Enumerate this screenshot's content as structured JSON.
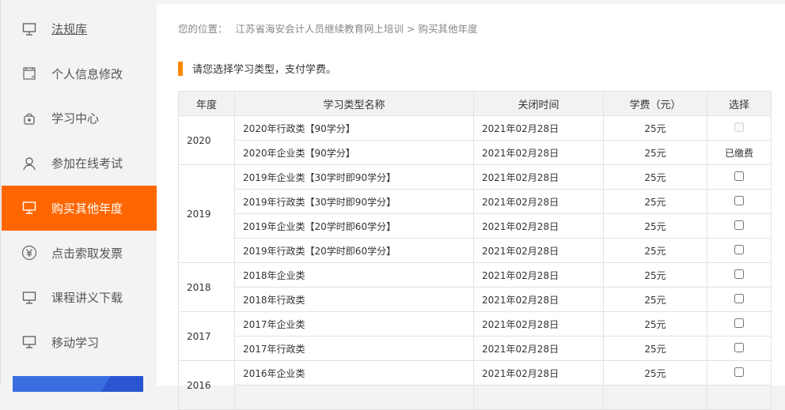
{
  "sidebar": {
    "items": [
      {
        "label": "法规库",
        "icon": "monitor-icon"
      },
      {
        "label": "个人信息修改",
        "icon": "calendar-icon"
      },
      {
        "label": "学习中心",
        "icon": "bag-icon"
      },
      {
        "label": "参加在线考试",
        "icon": "user-icon"
      },
      {
        "label": "购买其他年度",
        "icon": "monitor-icon",
        "active": true
      },
      {
        "label": "点击索取发票",
        "icon": "yen-icon"
      },
      {
        "label": "课程讲义下载",
        "icon": "monitor-icon"
      },
      {
        "label": "移动学习",
        "icon": "monitor-icon"
      }
    ]
  },
  "breadcrumb": {
    "prefix": "您的位置：",
    "site": "江苏省海安会计人员继续教育网上培训",
    "sep": ">",
    "current": "购买其他年度"
  },
  "tip": "请您选择学习类型，支付学费。",
  "table": {
    "headers": [
      "年度",
      "学习类型名称",
      "关闭时间",
      "学费（元）",
      "选择"
    ],
    "groups": [
      {
        "year": "2020",
        "rows": [
          {
            "name": "2020年行政类【90学分】",
            "date": "2021年02月28日",
            "fee": "25元",
            "select": "disabled"
          },
          {
            "name": "2020年企业类【90学分】",
            "date": "2021年02月28日",
            "fee": "25元",
            "select": "已缴费"
          }
        ]
      },
      {
        "year": "2019",
        "rows": [
          {
            "name": "2019年企业类【30学时即90学分】",
            "date": "2021年02月28日",
            "fee": "25元",
            "select": "checkbox"
          },
          {
            "name": "2019年行政类【30学时即90学分】",
            "date": "2021年02月28日",
            "fee": "25元",
            "select": "checkbox"
          },
          {
            "name": "2019年企业类【20学时即60学分】",
            "date": "2021年02月28日",
            "fee": "25元",
            "select": "checkbox"
          },
          {
            "name": "2019年行政类【20学时即60学分】",
            "date": "2021年02月28日",
            "fee": "25元",
            "select": "checkbox"
          }
        ]
      },
      {
        "year": "2018",
        "rows": [
          {
            "name": "2018年企业类",
            "date": "2021年02月28日",
            "fee": "25元",
            "select": "checkbox"
          },
          {
            "name": "2018年行政类",
            "date": "2021年02月28日",
            "fee": "25元",
            "select": "checkbox"
          }
        ]
      },
      {
        "year": "2017",
        "rows": [
          {
            "name": "2017年企业类",
            "date": "2021年02月28日",
            "fee": "25元",
            "select": "checkbox"
          },
          {
            "name": "2017年行政类",
            "date": "2021年02月28日",
            "fee": "25元",
            "select": "checkbox"
          }
        ]
      },
      {
        "year": "2016",
        "rows": [
          {
            "name": "2016年企业类",
            "date": "2021年02月28日",
            "fee": "25元",
            "select": "checkbox"
          },
          {
            "name": "",
            "date": "",
            "fee": "",
            "select": ""
          }
        ]
      }
    ]
  }
}
